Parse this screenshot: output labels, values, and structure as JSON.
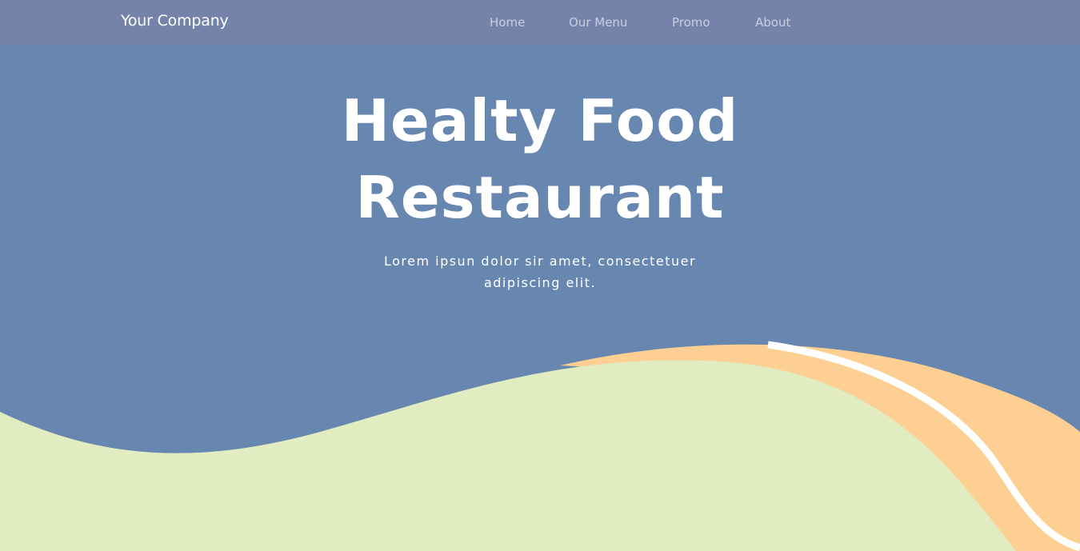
{
  "navbar": {
    "brand": "Your Company",
    "links": [
      {
        "label": "Home"
      },
      {
        "label": "Our Menu"
      },
      {
        "label": "Promo"
      },
      {
        "label": "About"
      }
    ]
  },
  "hero": {
    "title_line1": "Healty Food",
    "title_line2": "Restaurant",
    "subtitle_line1": "Lorem ipsun dolor sir amet, consectetuer",
    "subtitle_line2": "adipiscing elit."
  },
  "colors": {
    "background": "#6787b0",
    "navbar": "#7583ab",
    "wave_green": "#e1ecc1",
    "wave_orange": "#fecf92",
    "wave_stripe": "#ffffff",
    "text": "#ffffff",
    "nav_text": "#c8cde0"
  }
}
